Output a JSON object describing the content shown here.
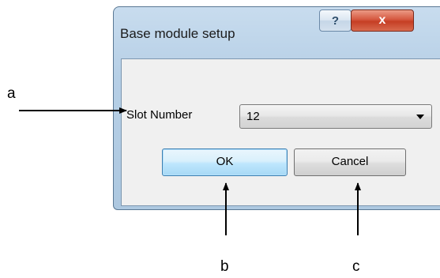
{
  "dialog": {
    "title": "Base module setup",
    "help_label": "?",
    "close_label": "x",
    "slot_label": "Slot Number",
    "slot_value": "12",
    "ok_label": "OK",
    "cancel_label": "Cancel"
  },
  "annotations": {
    "a": "a",
    "b": "b",
    "c": "c"
  }
}
